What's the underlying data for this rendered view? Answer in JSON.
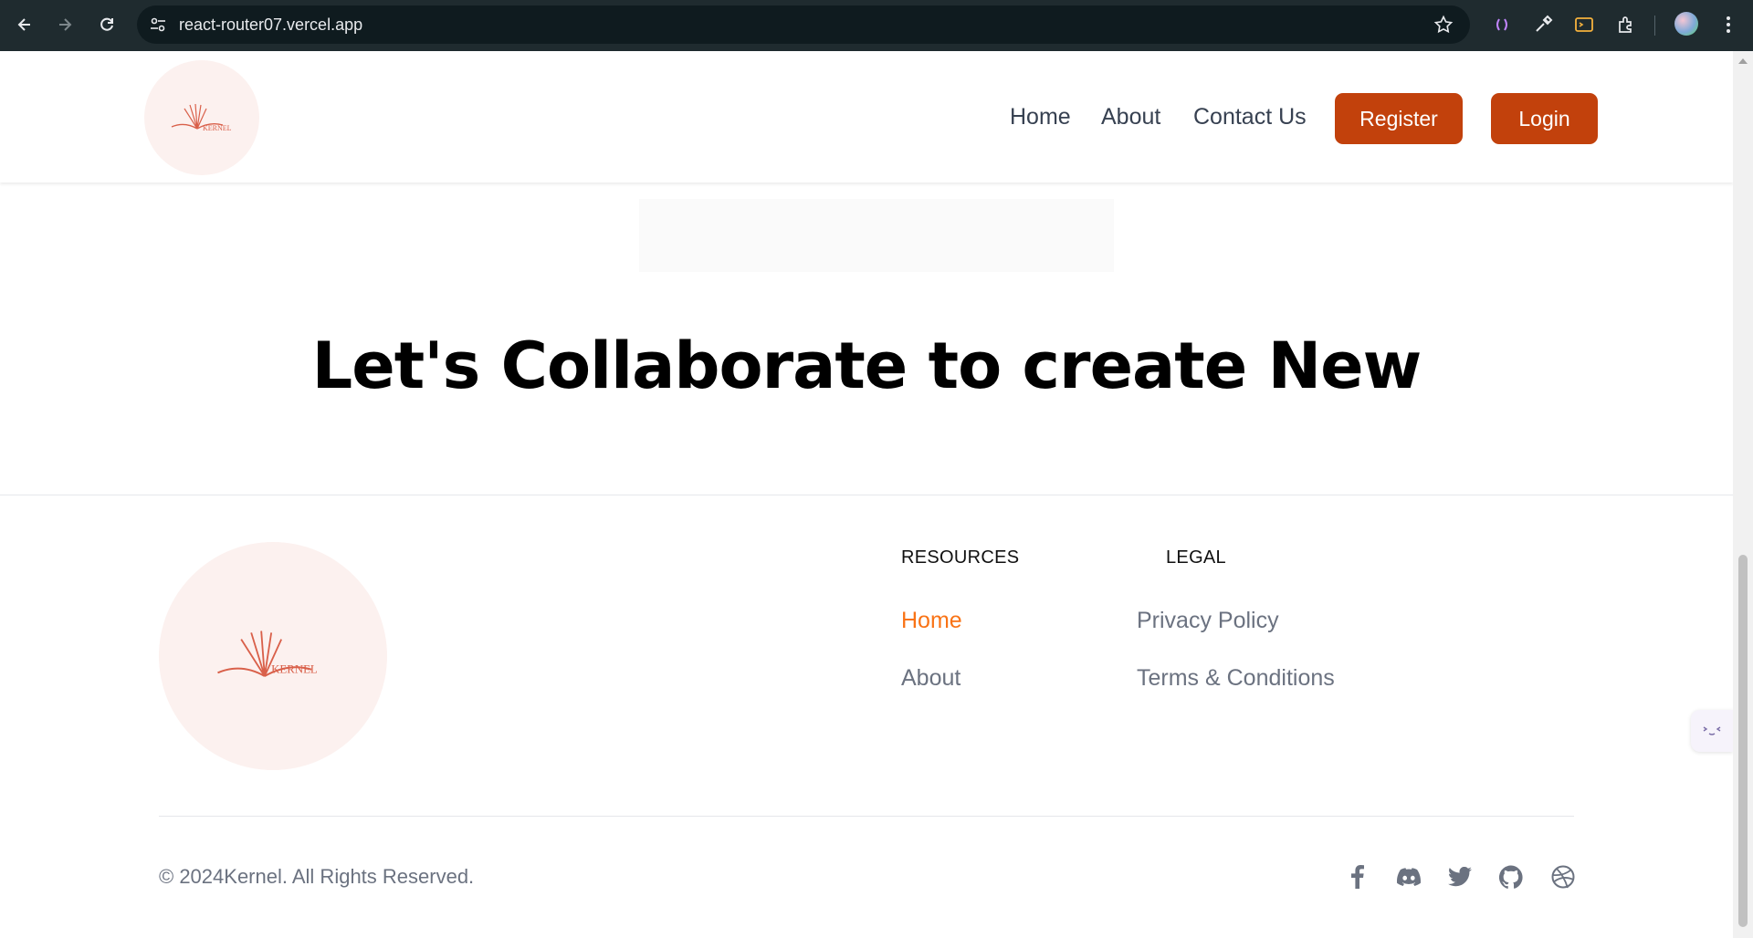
{
  "browser": {
    "url": "react-router07.vercel.app"
  },
  "header": {
    "logo_text": "KERNEL",
    "nav": [
      {
        "label": "Home"
      },
      {
        "label": "About"
      },
      {
        "label": "Contact Us"
      }
    ],
    "register_label": "Register",
    "login_label": "Login"
  },
  "hero": {
    "title": "Let's Collaborate to create New"
  },
  "footer": {
    "logo_text": "KERNEL",
    "resources_heading": "RESOURCES",
    "legal_heading": "LEGAL",
    "resources_links": [
      {
        "label": "Home",
        "active": true
      },
      {
        "label": "About",
        "active": false
      }
    ],
    "legal_links": [
      {
        "label": "Privacy Policy"
      },
      {
        "label": "Terms & Conditions"
      }
    ],
    "copyright": "© 2024Kernel. All Rights Reserved.",
    "social_icons": [
      "facebook-icon",
      "discord-icon",
      "twitter-icon",
      "github-icon",
      "dribbble-icon"
    ]
  },
  "colors": {
    "brand_button": "#c2410c",
    "active_link": "#f97316",
    "logo_bg": "#fcf1ef",
    "logo_stroke": "#d9604a"
  }
}
